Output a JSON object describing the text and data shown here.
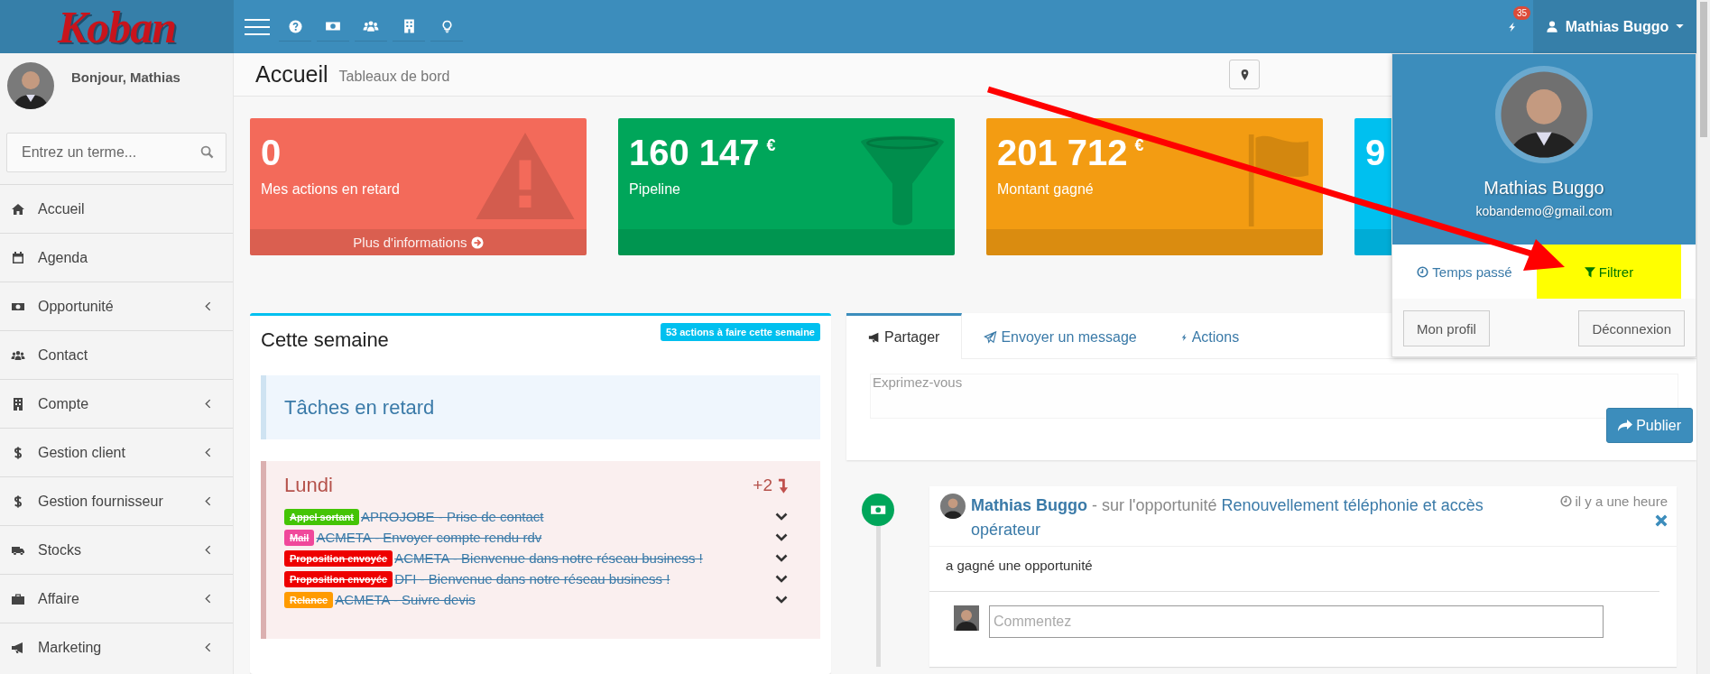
{
  "topbar": {
    "logo": "Koban",
    "notification_count": "35",
    "user_name": "Mathias Buggo"
  },
  "sidebar": {
    "greeting": "Bonjour, Mathias",
    "search": {
      "placeholder": "Entrez un terme..."
    },
    "items": [
      {
        "label": "Accueil",
        "has_submenu": false
      },
      {
        "label": "Agenda",
        "has_submenu": false
      },
      {
        "label": "Opportunité",
        "has_submenu": true
      },
      {
        "label": "Contact",
        "has_submenu": false
      },
      {
        "label": "Compte",
        "has_submenu": true
      },
      {
        "label": "Gestion client",
        "has_submenu": true
      },
      {
        "label": "Gestion fournisseur",
        "has_submenu": true
      },
      {
        "label": "Stocks",
        "has_submenu": true
      },
      {
        "label": "Affaire",
        "has_submenu": true
      },
      {
        "label": "Marketing",
        "has_submenu": true
      }
    ]
  },
  "header": {
    "title": "Accueil",
    "subtitle": "Tableaux de bord"
  },
  "cards": [
    {
      "value": "0",
      "label": "Mes actions en retard",
      "footer": "Plus d'informations",
      "color": "#f36a5a"
    },
    {
      "value": "160 147",
      "unit": "€",
      "label": "Pipeline",
      "color": "#00a65a"
    },
    {
      "value": "201 712",
      "unit": "€",
      "label": "Montant gagné",
      "color": "#f39c12"
    },
    {
      "value": "9",
      "color": "#00c0ef"
    }
  ],
  "week": {
    "title": "Cette semaine",
    "badge": "53 actions à faire cette semaine",
    "overdue_title": "Tâches en retard",
    "days": [
      {
        "name": "Lundi",
        "extra": "+2",
        "tasks": [
          {
            "tag": "Appel sortant",
            "color": "#44c405",
            "text": "APROJOBE - Prise de contact",
            "done": true
          },
          {
            "tag": "Mail",
            "color": "#f0489b",
            "text": "ACMETA - Envoyer compte rendu rdv",
            "done": true
          },
          {
            "tag": "Proposition envoyée",
            "color": "#ee0000",
            "text": "ACMETA - Bienvenue dans notre réseau business !",
            "done": true
          },
          {
            "tag": "Proposition envoyée",
            "color": "#ee0000",
            "text": "DFI - Bienvenue dans notre réseau business !",
            "done": true
          },
          {
            "tag": "Relance",
            "color": "#ff9b00",
            "text": "ACMETA - Suivre devis",
            "done": true
          }
        ]
      }
    ]
  },
  "share": {
    "tabs": [
      {
        "label": "Partager",
        "selected": true
      },
      {
        "label": "Envoyer un message",
        "selected": false
      },
      {
        "label": "Actions",
        "selected": false
      }
    ],
    "placeholder": "Exprimez-vous",
    "button": "Publier"
  },
  "feed": [
    {
      "author": "Mathias Buggo",
      "context": "- sur l'opportunité",
      "link": "Renouvellement téléphonie et accès opérateur",
      "time": "il y a une heure",
      "body": "a gagné une opportunité",
      "comment_placeholder": "Commentez"
    }
  ],
  "user_menu": {
    "name": "Mathias Buggo",
    "email": "kobandemo@gmail.com",
    "links": [
      {
        "label": "Temps passé",
        "highlighted": false
      },
      {
        "label": "Filtrer",
        "highlighted": true
      }
    ],
    "buttons": [
      "Mon profil",
      "Déconnexion"
    ]
  }
}
